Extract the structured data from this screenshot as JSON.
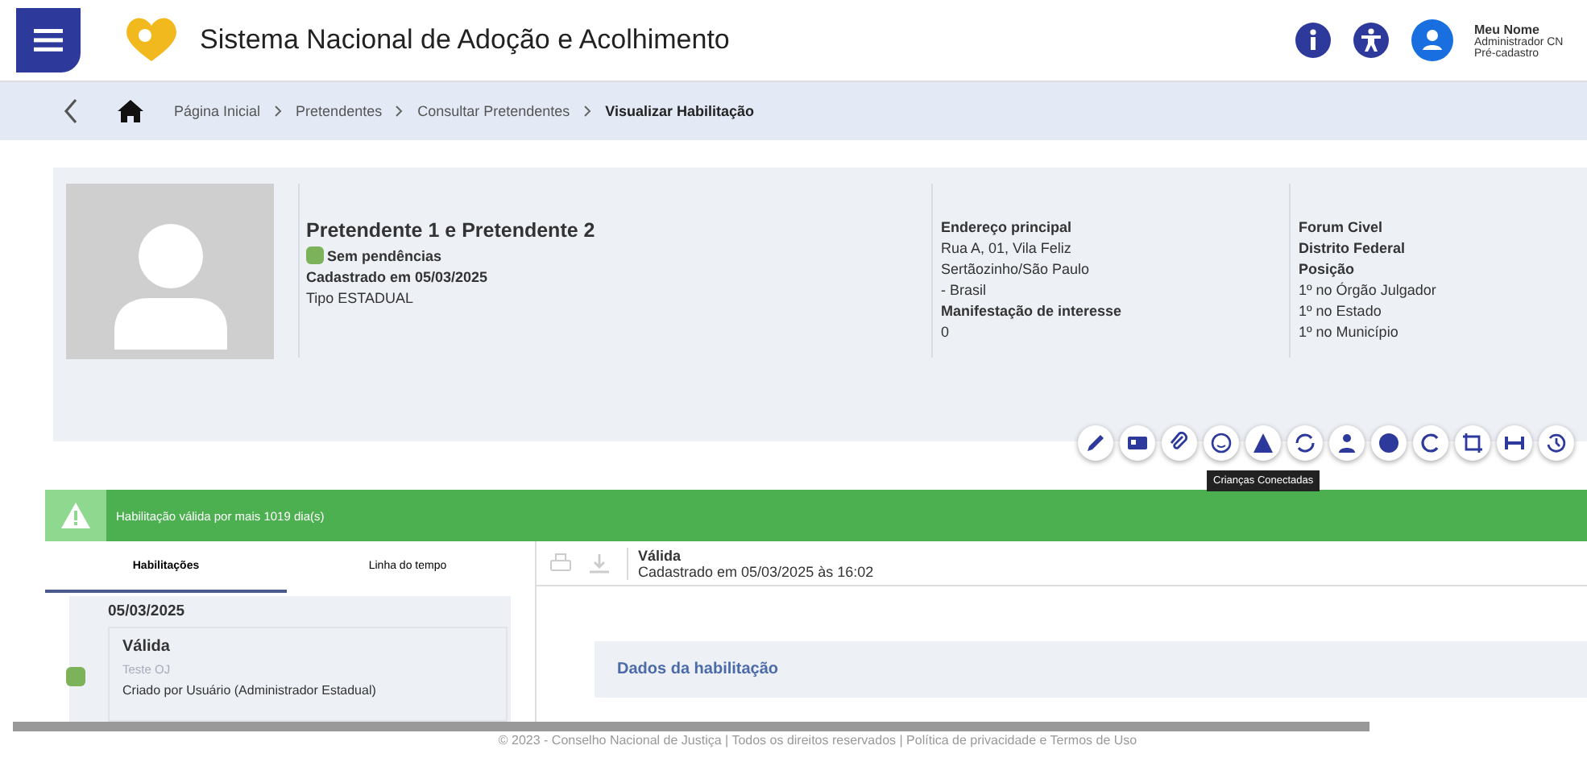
{
  "header": {
    "title": "Sistema Nacional de Adoção e Acolhimento",
    "user": {
      "name": "Meu Nome",
      "role": "Administrador CN",
      "profile": "Pré-cadastro"
    }
  },
  "breadcrumb": [
    "Página Inicial",
    "Pretendentes",
    "Consultar Pretendentes",
    "Visualizar Habilitação"
  ],
  "profile": {
    "name": "Pretendente 1 e Pretendente 2",
    "status": {
      "label": "Sem pendências",
      "color": "#7cb35a"
    },
    "registered": "Cadastrado em 05/03/2025",
    "type": "Tipo ESTADUAL",
    "address": [
      {
        "text": "Endereço principal",
        "bold": true
      },
      {
        "text": "Rua A, 01, Vila Feliz",
        "bold": false
      },
      {
        "text": "Sertãozinho/São Paulo",
        "bold": false
      },
      {
        "text": "- Brasil",
        "bold": false
      },
      {
        "text": "Manifestação de interesse",
        "bold": true
      },
      {
        "text": "0",
        "bold": false
      }
    ],
    "court": [
      {
        "text": "Forum Civel",
        "bold": true
      },
      {
        "text": "Distrito Federal",
        "bold": true
      },
      {
        "text": "Posição",
        "bold": true
      },
      {
        "text": "1º no Órgão Julgador",
        "bold": false
      },
      {
        "text": "1º no Estado",
        "bold": false
      },
      {
        "text": "1º no Município",
        "bold": false
      }
    ]
  },
  "actions": [
    {
      "kind": "pencil"
    },
    {
      "kind": "card"
    },
    {
      "kind": "clip"
    },
    {
      "kind": "face"
    },
    {
      "kind": "warning"
    },
    {
      "kind": "sync"
    },
    {
      "kind": "person"
    },
    {
      "kind": "stop"
    },
    {
      "kind": "redo"
    },
    {
      "kind": "crop"
    },
    {
      "kind": "link"
    },
    {
      "kind": "history"
    }
  ],
  "tooltip": "Crianças Conectadas",
  "alert": "Habilitação válida por mais 1019 dia(s)",
  "tabs": [
    {
      "label": "Habilitações",
      "selected": true
    },
    {
      "label": "Linha do tempo",
      "selected": false
    }
  ],
  "timeline": {
    "date": "05/03/2025",
    "title": "Válida",
    "subtitle": "Teste OJ",
    "note": "Criado por Usuário (Administrador Estadual)",
    "color": "#7cb35a"
  },
  "detail": {
    "title": "Válida",
    "subtitle": "Cadastrado em 05/03/2025 às 16:02",
    "section": "Dados da habilitação"
  },
  "footer": "© 2023 - Conselho Nacional de Justiça | Todos os direitos reservados | Política de privacidade e Termos de Uso"
}
